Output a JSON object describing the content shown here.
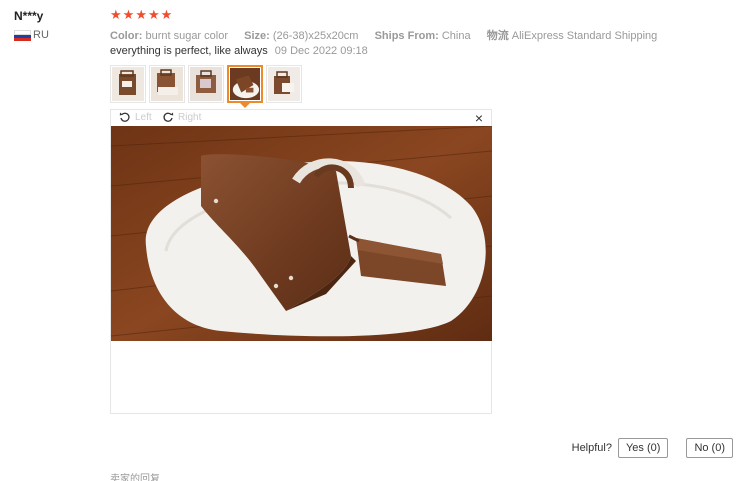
{
  "review": {
    "user_name": "N***y",
    "country_code": "RU",
    "rating": 5,
    "color_key": "Color:",
    "color_value": "burnt sugar color",
    "size_key": "Size:",
    "size_value": "(26-38)x25x20cm",
    "ships_key": "Ships From:",
    "ships_value": "China",
    "logistics_key": "物流",
    "logistics_value": "AliExpress Standard Shipping",
    "text": "everything is perfect, like always",
    "date": "09 Dec 2022 09:18"
  },
  "viewer": {
    "rotate_left": "Left",
    "rotate_right": "Right",
    "close_glyph": "×",
    "selected_thumb": 4
  },
  "helpful": {
    "label": "Helpful?",
    "yes": "Yes (0)",
    "no": "No (0)"
  },
  "footer_text": "卖家的回复",
  "colors": {
    "star": "#f04d2f",
    "active_thumb": "#ef8a2a",
    "muted_text": "#999999"
  }
}
